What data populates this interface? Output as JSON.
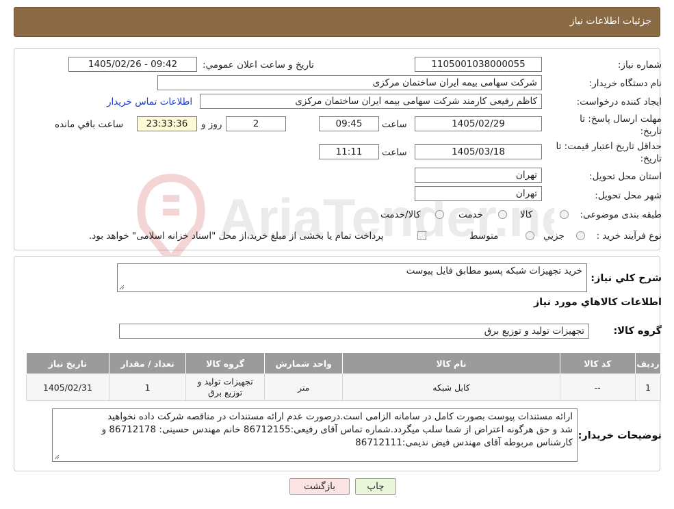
{
  "header": {
    "title": "جزئیات اطلاعات نیاز"
  },
  "form": {
    "need_number_label": "شماره نیاز:",
    "need_number": "1105001038000055",
    "announce_label": "تاریخ و ساعت اعلان عمومي:",
    "announce_value": "1405/02/26 - 09:42",
    "buyer_org_label": "نام دستگاه خريدار:",
    "buyer_org": "شرکت سهامی بیمه ایران ساختمان مرکزی",
    "creator_label": "ايجاد کننده درخواست:",
    "creator": "کاظم رفیعی کارمند شرکت سهامی بیمه ایران ساختمان مرکزی",
    "contact_link": "اطلاعات تماس خريدار",
    "deadline_label_1": "مهلت ارسال پاسخ: تا",
    "deadline_label_2": "تاريخ:",
    "deadline_date": "1405/02/29",
    "time_label": "ساعت",
    "deadline_time": "09:45",
    "days_value": "2",
    "days_label": "روز و",
    "remaining_value": "23:33:36",
    "remaining_label": "ساعت باقي مانده",
    "min_validity_label_1": "حداقل تاريخ اعتبار قيمت: تا",
    "min_validity_label_2": "تاريخ:",
    "validity_date": "1405/03/18",
    "validity_time": "11:11",
    "province_label": "استان محل تحويل:",
    "province": "تهران",
    "city_label": "شهر محل تحويل:",
    "city": "تهران",
    "category_label": "طبقه بندی موضوعی:",
    "category_options": [
      "کالا",
      "خدمت",
      "کالا/خدمت"
    ],
    "process_label": "نوع فرآيند خريد :",
    "process_options": [
      "جزيي",
      "متوسط"
    ],
    "process_note": "پرداخت تمام یا بخشی از مبلغ خرید،از محل \"اسناد خزانه اسلامی\" خواهد بود."
  },
  "watermark_text": "AriaTender.neT",
  "summary": {
    "label": "شرح کلي نياز:",
    "value": "خرید تجهیزات شبکه پسیو مطابق فایل پیوست"
  },
  "goods": {
    "section_title": "اطلاعات کالاهاي مورد نياز",
    "group_label": "گروه کالا:",
    "group_value": "تجهیزات تولید و توزیع برق",
    "table": {
      "headers": [
        "رديف",
        "کد کالا",
        "نام کالا",
        "واحد شمارش",
        "گروه کالا",
        "تعداد / مقدار",
        "تاريخ نياز"
      ],
      "rows": [
        [
          "1",
          "--",
          "کابل شبکه",
          "متر",
          "تجهیزات تولید و توزیع برق",
          "1",
          "1405/02/31"
        ]
      ]
    }
  },
  "buyer_notes": {
    "label": "توضيحات خريدار:",
    "lines": [
      "ارائه مستندات پیوست بصورت کامل در سامانه الزامی است.درصورت عدم ارائه مستندات در مناقصه شرکت داده نخواهید",
      "شد و حق هرگونه اعتراض از شما سلب میگردد.شماره تماس آقای رفیعی:86712155  خانم مهندس حسینی: 86712178 و",
      "کارشناس مربوطه آقای مهندس فیض ندیمی:86712111"
    ]
  },
  "buttons": {
    "print": "چاپ",
    "back": "بازگشت"
  }
}
